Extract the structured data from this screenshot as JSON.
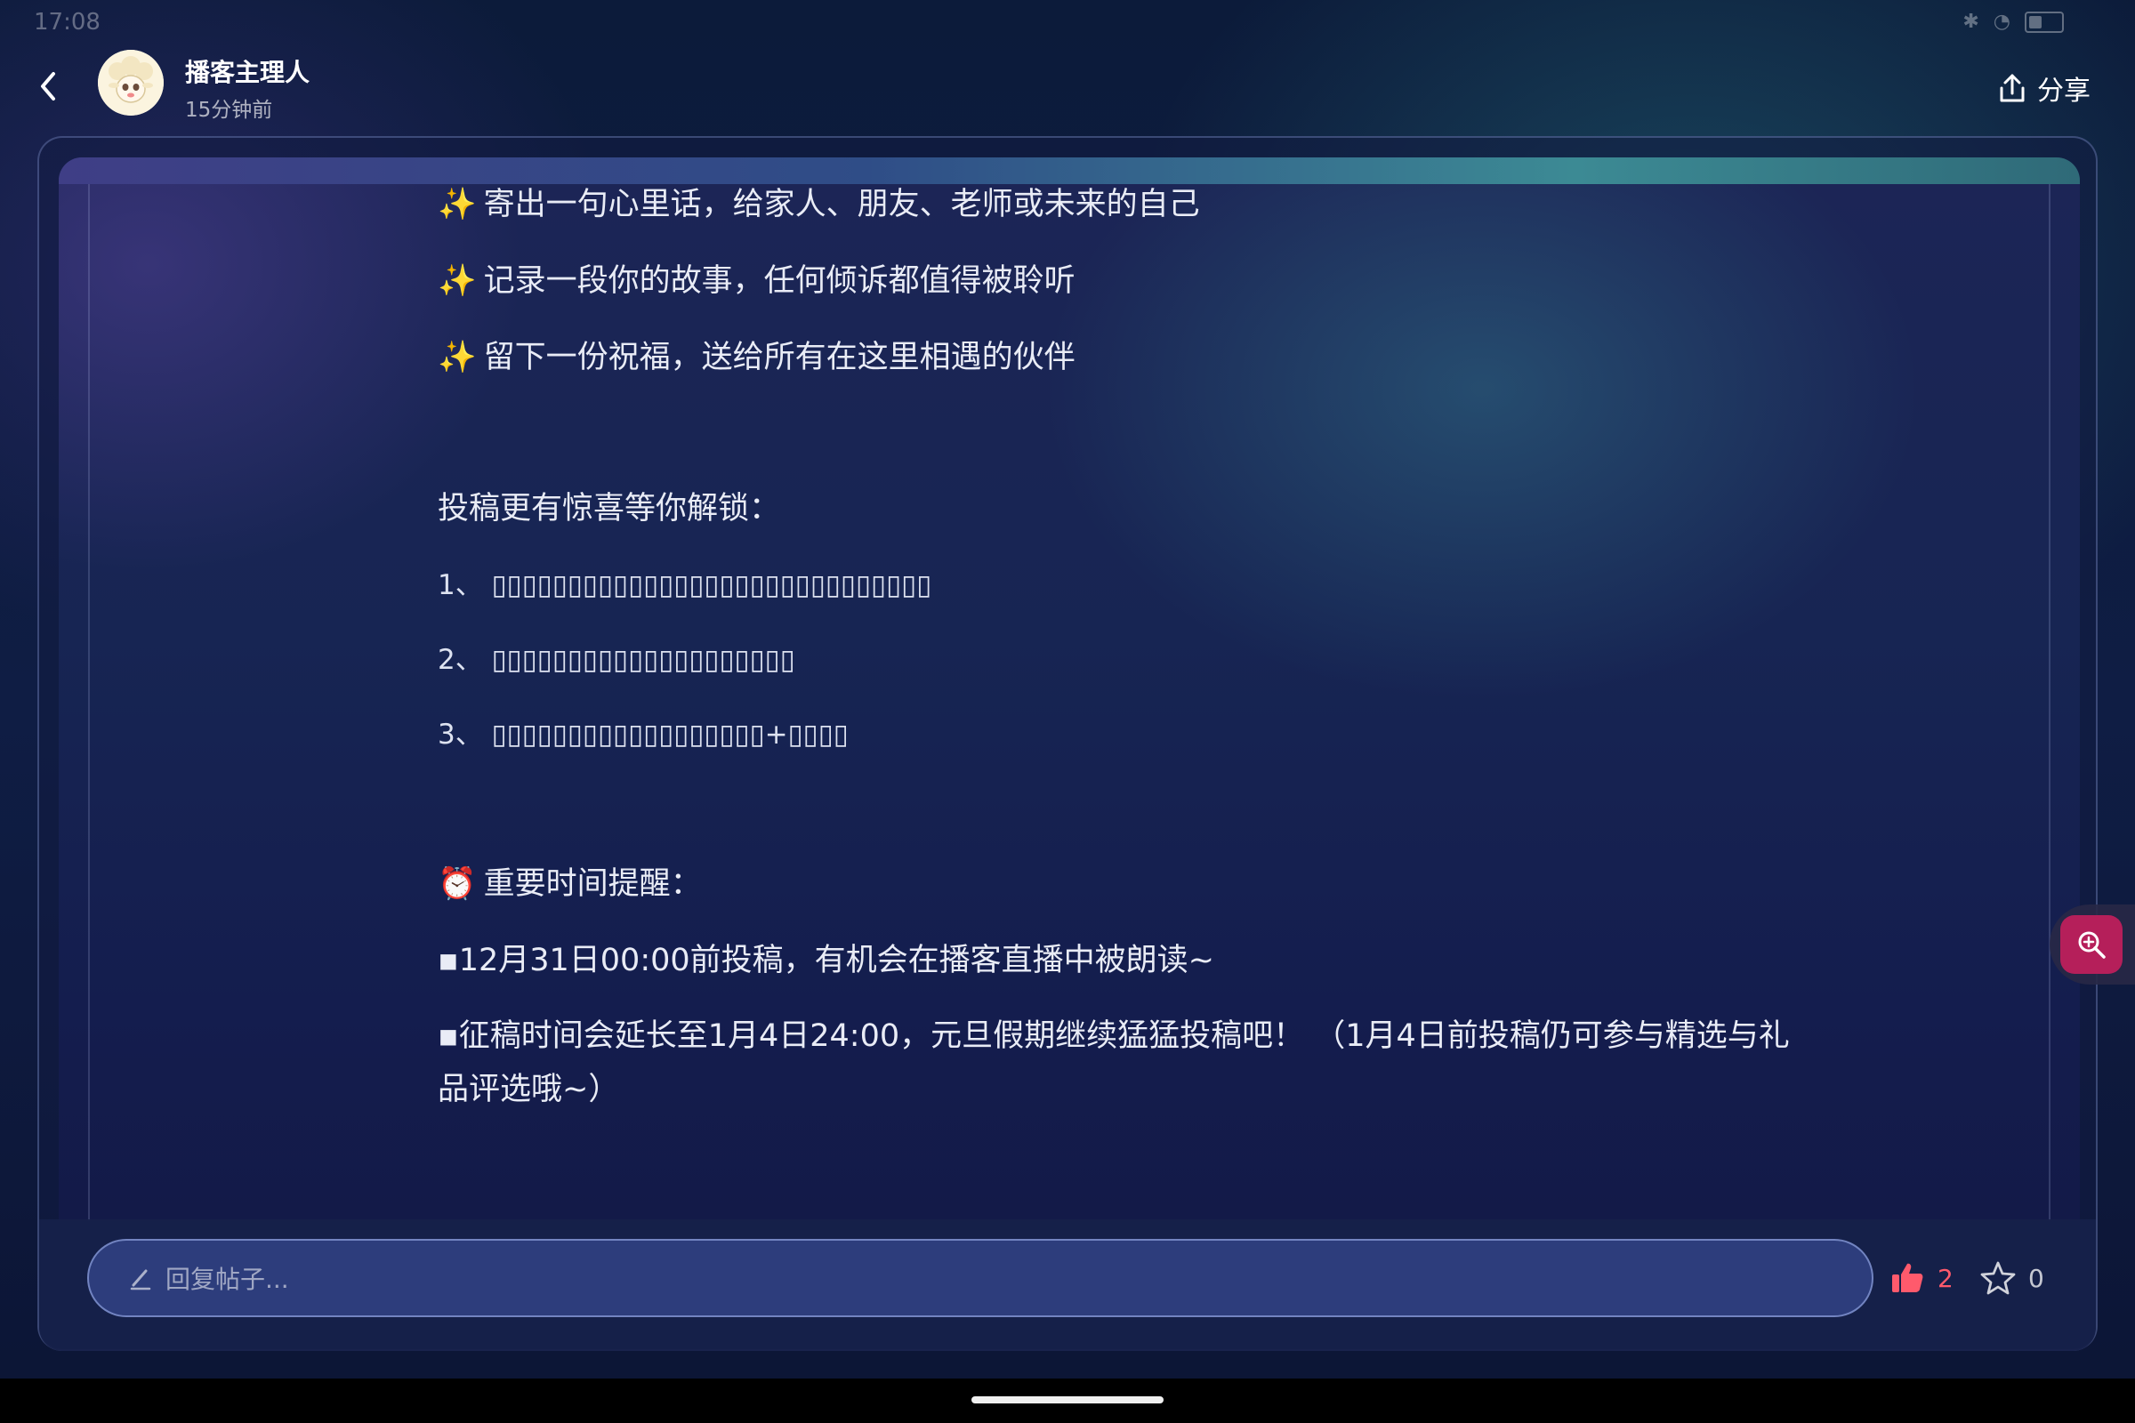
{
  "status_bar": {
    "time": "17:08",
    "icons": [
      "bluetooth-icon",
      "wifi-icon",
      "battery-icon"
    ]
  },
  "header": {
    "author_name": "播客主理人",
    "post_time": "15分钟前",
    "share_label": "分享"
  },
  "post": {
    "lines": [
      "寄出一句心里话，给家人、朋友、老师或未来的自己",
      "记录一段你的故事，任何倾诉都值得被聆听",
      "留下一份祝福，送给所有在这里相遇的伙伴"
    ],
    "unlock_heading": "投稿更有惊喜等你解锁：",
    "unlock_items": [
      "1、 ▯▯▯▯▯▯▯▯▯▯▯▯▯▯▯▯▯▯▯▯▯▯▯▯▯▯▯▯▯",
      "2、 ▯▯▯▯▯▯▯▯▯▯▯▯▯▯▯▯▯▯▯▯",
      "3、 ▯▯▯▯▯▯▯▯▯▯▯▯▯▯▯▯▯▯+▯▯▯▯"
    ],
    "time_heading": "重要时间提醒：",
    "time_items": [
      "▪12月31日00:00前投稿，有机会在播客直播中被朗读~",
      "▪征稿时间会延长至1月4日24:00，元旦假期继续猛猛投稿吧！ （1月4日前投稿仍可参与精选与礼品评选哦~）"
    ]
  },
  "reply": {
    "placeholder": "回复帖子...",
    "like_count": "2",
    "favorite_count": "0"
  },
  "colors": {
    "accent_like": "#ff5a6c",
    "zoom_button": "#b51f5a",
    "background": "#0f1d44"
  }
}
